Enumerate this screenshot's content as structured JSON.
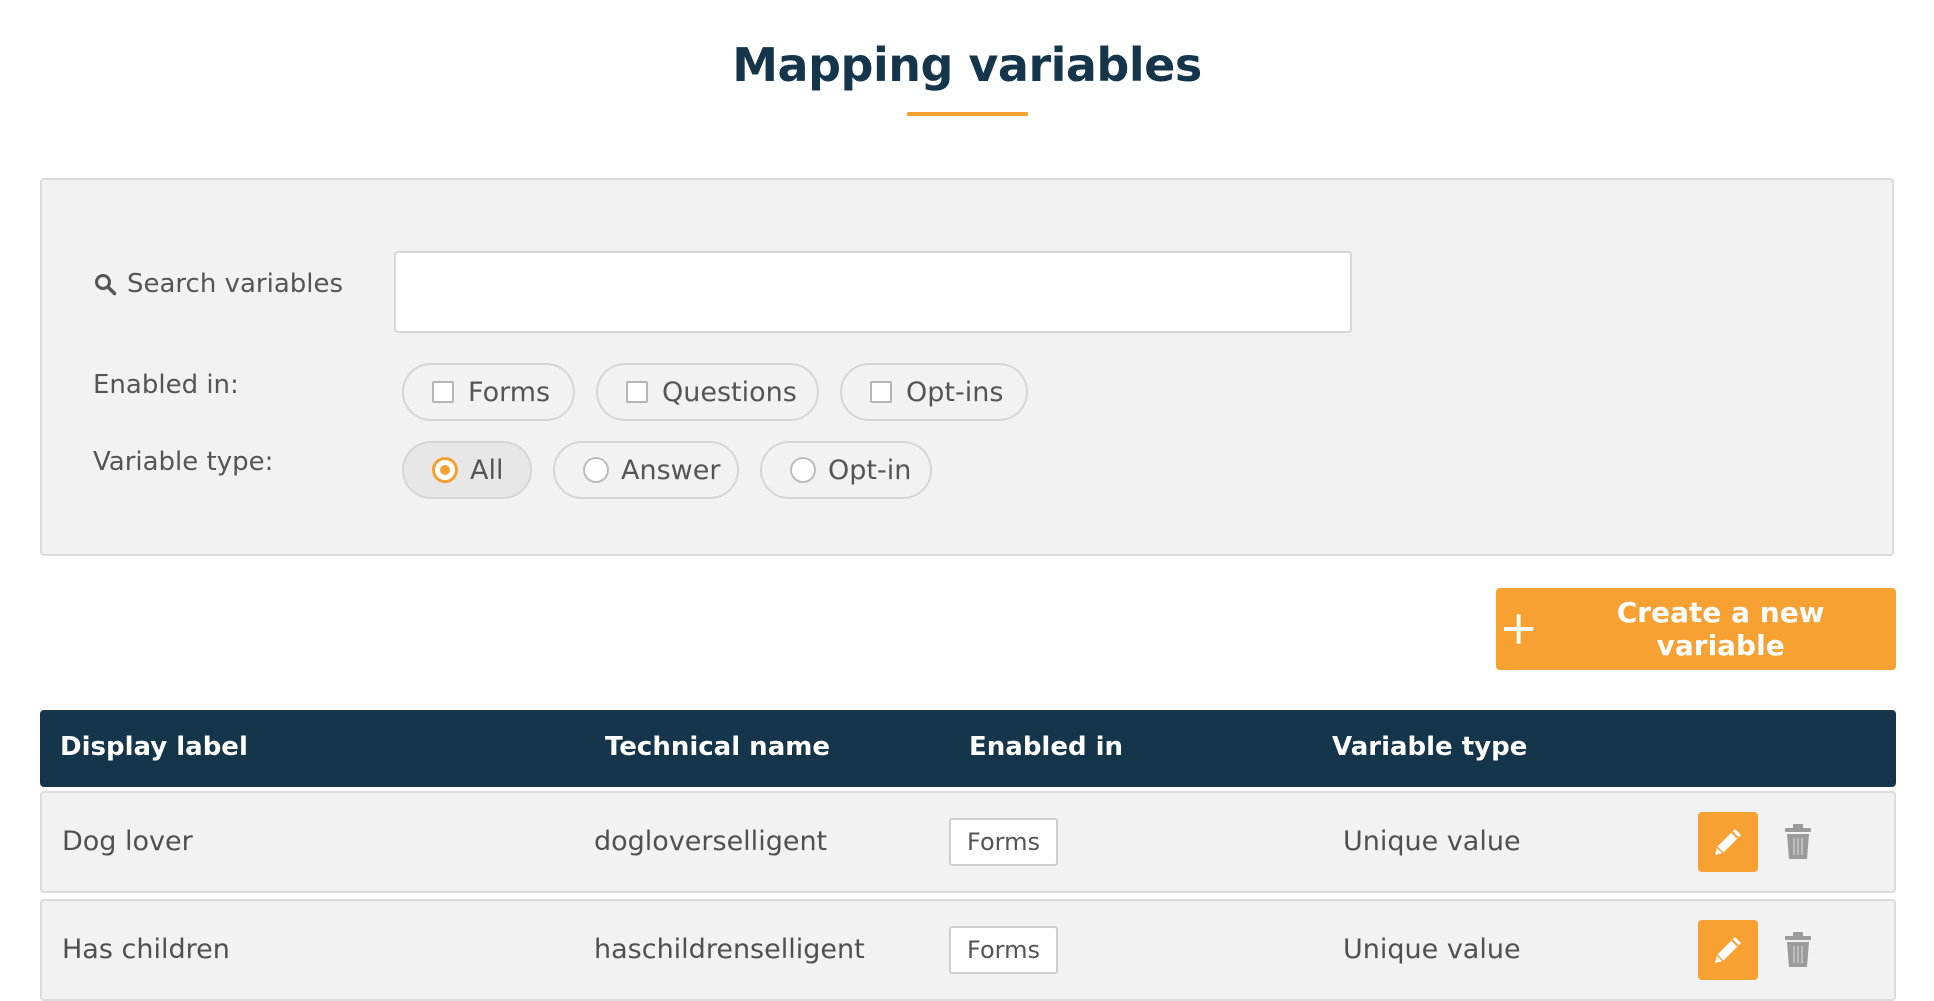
{
  "page": {
    "title": "Mapping variables"
  },
  "filters": {
    "search_label": "Search variables",
    "search_value": "",
    "search_placeholder": "",
    "enabled_in_label": "Enabled in:",
    "enabled_in_options": [
      {
        "label": "Forms",
        "checked": false
      },
      {
        "label": "Questions",
        "checked": false
      },
      {
        "label": "Opt-ins",
        "checked": false
      }
    ],
    "variable_type_label": "Variable type:",
    "variable_type_options": [
      {
        "label": "All",
        "selected": true
      },
      {
        "label": "Answer",
        "selected": false
      },
      {
        "label": "Opt-in",
        "selected": false
      }
    ]
  },
  "actions": {
    "create_label": "Create a new variable"
  },
  "table": {
    "columns": [
      "Display label",
      "Technical name",
      "Enabled in",
      "Variable type"
    ],
    "rows": [
      {
        "display_label": "Dog lover",
        "technical_name": "dogloverselligent",
        "enabled_in": "Forms",
        "variable_type": "Unique value"
      },
      {
        "display_label": "Has children",
        "technical_name": "haschildrenselligent",
        "enabled_in": "Forms",
        "variable_type": "Unique value"
      }
    ]
  },
  "icons": {
    "search": "search-icon",
    "plus": "plus-icon",
    "edit": "pencil-icon",
    "delete": "trash-icon"
  },
  "colors": {
    "accent": "#f7a133",
    "header_bg": "#15364a",
    "panel_bg": "#f2f2f2"
  }
}
